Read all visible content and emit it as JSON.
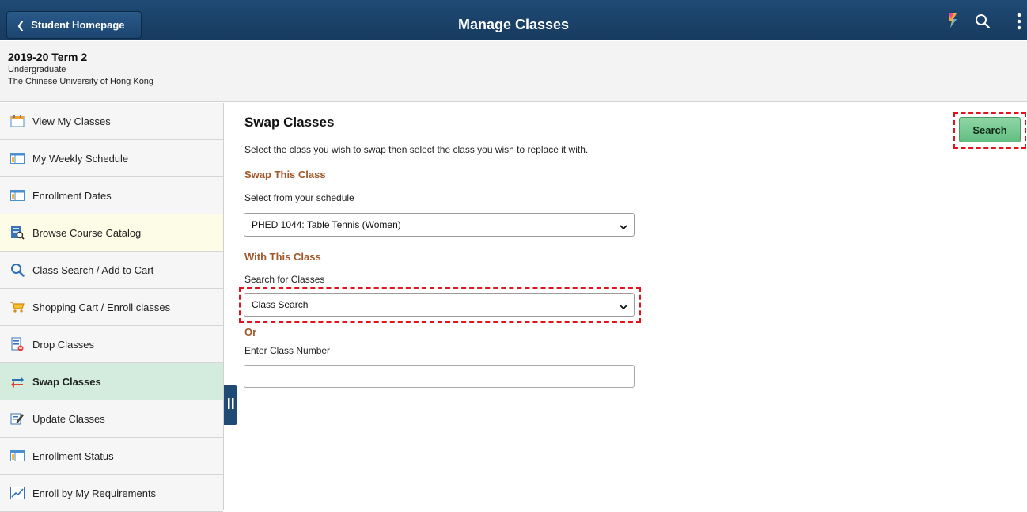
{
  "header": {
    "back_label": "Student Homepage",
    "title": "Manage Classes",
    "icons": [
      "navbar-flag-icon",
      "search-icon",
      "kebab-menu-icon"
    ]
  },
  "context": {
    "term": "2019-20 Term 2",
    "career": "Undergraduate",
    "institution": "The Chinese University of Hong Kong"
  },
  "sidebar": {
    "items": [
      {
        "label": "View My Classes",
        "icon": "calendar-icon"
      },
      {
        "label": "My Weekly Schedule",
        "icon": "schedule-grid-icon"
      },
      {
        "label": "Enrollment Dates",
        "icon": "schedule-grid-icon"
      },
      {
        "label": "Browse Course Catalog",
        "icon": "catalog-icon"
      },
      {
        "label": "Class Search / Add to Cart",
        "icon": "search-icon"
      },
      {
        "label": "Shopping Cart / Enroll classes",
        "icon": "cart-icon"
      },
      {
        "label": "Drop Classes",
        "icon": "drop-list-icon"
      },
      {
        "label": "Swap Classes",
        "icon": "swap-arrows-icon"
      },
      {
        "label": "Update Classes",
        "icon": "edit-note-icon"
      },
      {
        "label": "Enrollment Status",
        "icon": "schedule-grid-icon"
      },
      {
        "label": "Enroll by My Requirements",
        "icon": "chart-line-icon"
      }
    ],
    "active_index": 7,
    "hover_index": 3
  },
  "main": {
    "title": "Swap Classes",
    "instructions": "Select the class you wish to swap then select the class you wish to replace it with.",
    "swap_section": {
      "title": "Swap This Class",
      "label": "Select from your schedule",
      "selected": "PHED 1044: Table Tennis (Women)"
    },
    "with_section": {
      "title": "With This Class",
      "label": "Search for Classes",
      "selected": "Class Search",
      "or_label": "Or",
      "class_number_label": "Enter Class Number",
      "class_number_value": ""
    },
    "search_button": "Search"
  },
  "colors": {
    "header_bg": "#1f4a75",
    "section_title": "#a0582a",
    "active_nav": "#d4ecdd",
    "hover_nav": "#fdfce6",
    "search_button": "#62be82",
    "highlight_dash": "#e0141a"
  }
}
